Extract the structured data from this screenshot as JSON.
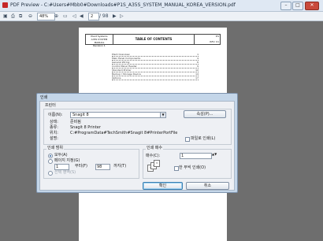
{
  "window": {
    "title": "PDF Preview - C:#Users#Mbb0#Downloads#P1S_A35S_SYSTEM_MANUAL_KOREA_VERSION.pdf",
    "minimize": "–",
    "maximize": "□",
    "close": "✕"
  },
  "toolbar": {
    "zoom": "48%",
    "page_current": "2",
    "page_total": "/ 98"
  },
  "document": {
    "header_left": [
      "Plant Systems",
      "A35S SYSTEM MANUAL",
      "Revision 1"
    ],
    "header_title": "TABLE OF CONTENTS",
    "header_right": [
      "P.S",
      "REV: 01"
    ],
    "toc": [
      {
        "text": "Plant Overview",
        "page": "1"
      },
      {
        "text": "Main Panel Components",
        "page": "4"
      },
      {
        "text": "General Wiring",
        "page": "6"
      },
      {
        "text": "Control Panel Header",
        "page": "9"
      },
      {
        "text": "Standard Printer",
        "page": "12"
      },
      {
        "text": "Backup / Storage Device",
        "page": "14"
      },
      {
        "text": "Options",
        "page": "17"
      }
    ]
  },
  "dialog": {
    "title": "인쇄",
    "printer_section": "프린터",
    "name_label": "이름(N):",
    "printer_name": "Snagit 8",
    "properties_button": "속성(P)...",
    "status_label": "상태:",
    "status_value": "준비됨",
    "type_label": "종류:",
    "type_value": "Snagit 8 Printer",
    "where_label": "위치:",
    "where_value": "C:#ProgramData#TechSmith#Snagit 8#PrinterPortFile",
    "comment_label": "설명:",
    "print_to_file_label": "파일로 인쇄(L)",
    "print_to_file": false,
    "range_section": "인쇄 범위",
    "range_all": "모두(A)",
    "range_pages": "페이지 지정(G)",
    "range_from": "1",
    "range_from_label": "부터(F)",
    "range_to": "98",
    "range_to_label": "까지(T)",
    "range_selection": "선택 영역(S)",
    "copies_section": "인쇄 매수",
    "copies_label": "매수(C):",
    "copies_value": "1",
    "collate_label": "한 부씩 인쇄(O)",
    "collate": false,
    "ok_button": "확인",
    "cancel_button": "취소"
  }
}
